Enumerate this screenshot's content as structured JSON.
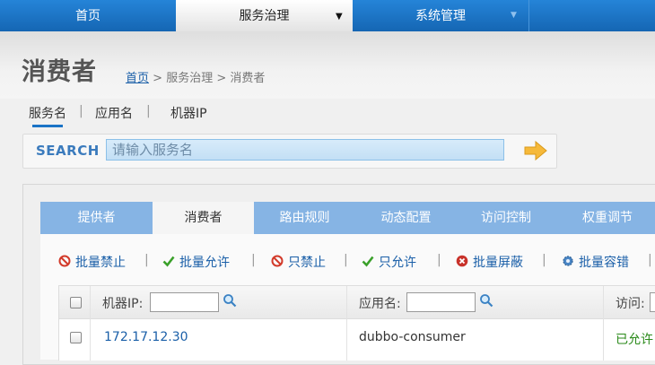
{
  "nav": {
    "items": [
      {
        "label": "首页"
      },
      {
        "label": "服务治理"
      },
      {
        "label": "系统管理"
      }
    ]
  },
  "page": {
    "title": "消费者",
    "breadcrumb": {
      "home": "首页",
      "sep1": ">",
      "section": "服务治理",
      "sep2": ">",
      "current": "消费者"
    }
  },
  "subtabs": {
    "items": [
      {
        "label": "服务名",
        "active": true
      },
      {
        "label": "应用名"
      },
      {
        "label": "机器IP"
      }
    ],
    "separator": "|"
  },
  "search": {
    "label": "SEARCH",
    "placeholder": "请输入服务名",
    "value": ""
  },
  "panel_tabs": [
    {
      "label": "提供者"
    },
    {
      "label": "消费者",
      "active": true
    },
    {
      "label": "路由规则"
    },
    {
      "label": "动态配置"
    },
    {
      "label": "访问控制"
    },
    {
      "label": "权重调节"
    }
  ],
  "actions": {
    "separator": "|",
    "items": [
      {
        "label": "批量禁止",
        "icon": "forbid-icon"
      },
      {
        "label": "批量允许",
        "icon": "check-icon"
      },
      {
        "label": "只禁止",
        "icon": "forbid-icon"
      },
      {
        "label": "只允许",
        "icon": "check-icon"
      },
      {
        "label": "批量屏蔽",
        "icon": "block-icon"
      },
      {
        "label": "批量容错",
        "icon": "gear-icon"
      }
    ]
  },
  "table": {
    "headers": {
      "ip": "机器IP:",
      "app": "应用名:",
      "access": "访问:"
    },
    "rows": [
      {
        "ip": "172.17.12.30",
        "app": "dubbo-consumer",
        "access": "已允许"
      }
    ]
  },
  "colors": {
    "nav_blue": "#1a73c6",
    "tab_blue": "#86b4e4",
    "link_blue": "#1a5fa8",
    "allowed_green": "#2a8a1a",
    "forbid_red": "#d23a2a"
  }
}
